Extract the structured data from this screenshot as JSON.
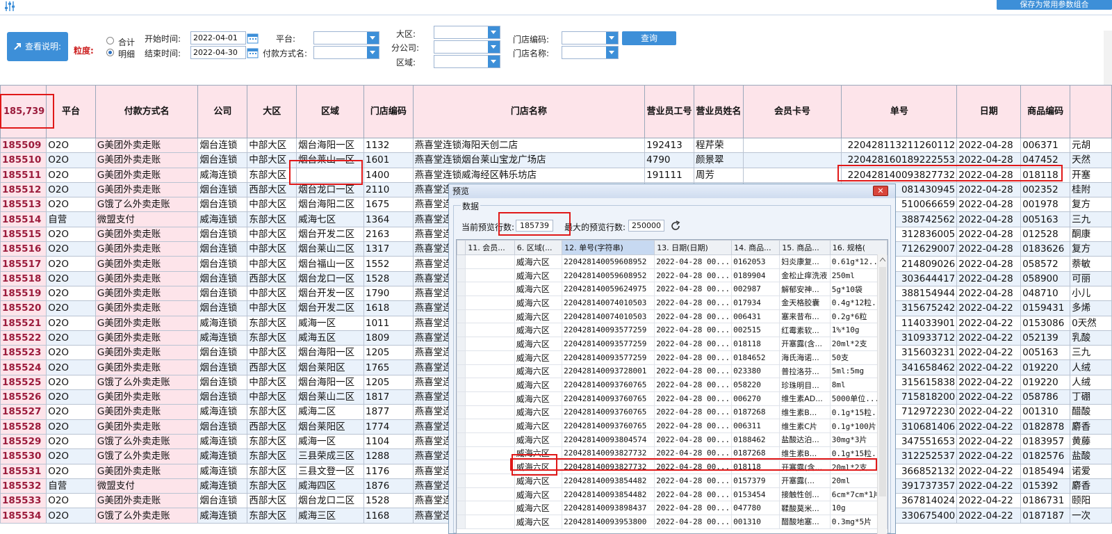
{
  "toolbar": {
    "save_combo_label": "保存为常用参数组合"
  },
  "filter": {
    "help_button": "查看说明:",
    "granularity_label": "粒度:",
    "radio_total": "合计",
    "radio_detail": "明细",
    "start_label": "开始时间:",
    "start_value": "2022-04-01",
    "end_label": "结束时间:",
    "end_value": "2022-04-30",
    "platform_label": "平台:",
    "payment_label": "付款方式名:",
    "region_label": "大区:",
    "branch_label": "分公司:",
    "area_label": "区域:",
    "store_code_label": "门店编码:",
    "store_name_label": "门店名称:",
    "query_button": "查询"
  },
  "main_table": {
    "total_count": "185,739",
    "headers": [
      "平台",
      "付款方式名",
      "公司",
      "大区",
      "区域",
      "门店编码",
      "门店名称",
      "营业员工号",
      "营业员姓名",
      "会员卡号",
      "单号",
      "日期",
      "商品编码"
    ],
    "rows": [
      [
        "185509",
        "O2O",
        "G美团外卖走账",
        "烟台连锁",
        "中部大区",
        "烟台海阳一区",
        "1132",
        "燕喜堂连锁海阳天创二店",
        "192413",
        "程芹荣",
        "",
        "220428113211260112",
        "2022-04-28",
        "006371",
        "元胡"
      ],
      [
        "185510",
        "O2O",
        "G美团外卖走账",
        "烟台连锁",
        "中部大区",
        "烟台莱山一区",
        "1601",
        "燕喜堂连锁烟台莱山宝龙广场店",
        "4790",
        "颜景翠",
        "",
        "220428160189222553",
        "2022-04-28",
        "047452",
        "天然"
      ],
      [
        "185511",
        "O2O",
        "G美团外卖走账",
        "威海连锁",
        "东部大区",
        "",
        "1400",
        "燕喜堂连锁威海经区韩乐坊店",
        "191111",
        "周芳",
        "",
        "220428140093827732",
        "2022-04-28",
        "018118",
        "开塞"
      ],
      [
        "185512",
        "O2O",
        "G美团外卖走账",
        "烟台连锁",
        "西部大区",
        "烟台龙口一区",
        "2110",
        "燕喜堂连",
        "",
        "",
        "",
        "081430945",
        "2022-04-28",
        "002352",
        "桂附"
      ],
      [
        "185513",
        "O2O",
        "G饿了么外卖走账",
        "烟台连锁",
        "中部大区",
        "烟台海阳二区",
        "1675",
        "燕喜堂连",
        "",
        "",
        "",
        "510066659",
        "2022-04-28",
        "001978",
        "复方"
      ],
      [
        "185514",
        "自营",
        "微盟支付",
        "威海连锁",
        "东部大区",
        "威海七区",
        "1364",
        "燕喜堂连",
        "",
        "",
        "",
        "388742562",
        "2022-04-28",
        "005163",
        "三九"
      ],
      [
        "185515",
        "O2O",
        "G美团外卖走账",
        "烟台连锁",
        "中部大区",
        "烟台开发二区",
        "2163",
        "燕喜堂连",
        "",
        "",
        "",
        "312836005",
        "2022-04-28",
        "012528",
        "酮康"
      ],
      [
        "185516",
        "O2O",
        "G美团外卖走账",
        "烟台连锁",
        "中部大区",
        "烟台莱山二区",
        "1317",
        "燕喜堂连",
        "",
        "",
        "",
        "712629007",
        "2022-04-28",
        "0183626",
        "复方"
      ],
      [
        "185517",
        "O2O",
        "G美团外卖走账",
        "烟台连锁",
        "中部大区",
        "烟台福山一区",
        "1552",
        "燕喜堂连",
        "",
        "",
        "",
        "214809026",
        "2022-04-28",
        "058572",
        "萘敏"
      ],
      [
        "185518",
        "O2O",
        "G美团外卖走账",
        "烟台连锁",
        "西部大区",
        "烟台龙口一区",
        "1528",
        "燕喜堂连",
        "",
        "",
        "",
        "303644417",
        "2022-04-28",
        "058900",
        "可丽"
      ],
      [
        "185519",
        "O2O",
        "G美团外卖走账",
        "烟台连锁",
        "中部大区",
        "烟台开发一区",
        "1790",
        "燕喜堂连",
        "",
        "",
        "",
        "388154944",
        "2022-04-28",
        "048710",
        "小儿"
      ],
      [
        "185520",
        "O2O",
        "G美团外卖走账",
        "烟台连锁",
        "中部大区",
        "烟台开发二区",
        "1618",
        "燕喜堂连",
        "",
        "",
        "",
        "315675242",
        "2022-04-22",
        "0159431",
        "多烯"
      ],
      [
        "185521",
        "O2O",
        "G美团外卖走账",
        "威海连锁",
        "东部大区",
        "威海一区",
        "1011",
        "燕喜堂连",
        "",
        "",
        "",
        "114033901",
        "2022-04-22",
        "0153086",
        "0天然"
      ],
      [
        "185522",
        "O2O",
        "G美团外卖走账",
        "威海连锁",
        "东部大区",
        "威海五区",
        "1809",
        "燕喜堂连",
        "",
        "",
        "",
        "310933712",
        "2022-04-22",
        "052139",
        "乳酸"
      ],
      [
        "185523",
        "O2O",
        "G美团外卖走账",
        "烟台连锁",
        "中部大区",
        "烟台海阳一区",
        "1205",
        "燕喜堂连",
        "",
        "",
        "",
        "315603231",
        "2022-04-22",
        "005163",
        "三九"
      ],
      [
        "185524",
        "O2O",
        "G美团外卖走账",
        "烟台连锁",
        "西部大区",
        "烟台莱阳区",
        "1765",
        "燕喜堂连",
        "",
        "",
        "",
        "341658462",
        "2022-04-22",
        "019220",
        "人绒"
      ],
      [
        "185525",
        "O2O",
        "G饿了么外卖走账",
        "烟台连锁",
        "中部大区",
        "烟台海阳一区",
        "1205",
        "燕喜堂连",
        "",
        "",
        "",
        "315615838",
        "2022-04-22",
        "019220",
        "人绒"
      ],
      [
        "185526",
        "O2O",
        "G美团外卖走账",
        "烟台连锁",
        "中部大区",
        "烟台莱山二区",
        "1817",
        "燕喜堂连",
        "",
        "",
        "",
        "715818200",
        "2022-04-22",
        "058786",
        "丁硼"
      ],
      [
        "185527",
        "O2O",
        "G美团外卖走账",
        "威海连锁",
        "东部大区",
        "威海二区",
        "1877",
        "燕喜堂连",
        "",
        "",
        "",
        "712972230",
        "2022-04-22",
        "001310",
        "醋酸"
      ],
      [
        "185528",
        "O2O",
        "G美团外卖走账",
        "烟台连锁",
        "西部大区",
        "烟台莱阳区",
        "1774",
        "燕喜堂连",
        "",
        "",
        "",
        "310681406",
        "2022-04-22",
        "0182878",
        "麝香"
      ],
      [
        "185529",
        "O2O",
        "G饿了么外卖走账",
        "威海连锁",
        "东部大区",
        "威海一区",
        "1104",
        "燕喜堂连",
        "",
        "",
        "",
        "347551653",
        "2022-04-22",
        "0183957",
        "黄藤"
      ],
      [
        "185530",
        "O2O",
        "G饿了么外卖走账",
        "威海连锁",
        "东部大区",
        "三县荣成三区",
        "1288",
        "燕喜堂连",
        "",
        "",
        "",
        "312252537",
        "2022-04-22",
        "0182576",
        "盐酸"
      ],
      [
        "185531",
        "O2O",
        "G美团外卖走账",
        "威海连锁",
        "东部大区",
        "三县文登一区",
        "1176",
        "燕喜堂连",
        "",
        "",
        "",
        "366852132",
        "2022-04-22",
        "0185494",
        "诺爱"
      ],
      [
        "185532",
        "自营",
        "微盟支付",
        "威海连锁",
        "东部大区",
        "威海四区",
        "1876",
        "燕喜堂连",
        "",
        "",
        "",
        "391737357",
        "2022-04-22",
        "015392",
        "麝香"
      ],
      [
        "185533",
        "O2O",
        "G美团外卖走账",
        "烟台连锁",
        "西部大区",
        "烟台龙口二区",
        "1528",
        "燕喜堂连",
        "",
        "",
        "",
        "367814024",
        "2022-04-22",
        "0186731",
        "颐阳"
      ],
      [
        "185534",
        "O2O",
        "G饿了么外卖走账",
        "威海连锁",
        "东部大区",
        "威海三区",
        "1168",
        "燕喜堂连",
        "",
        "",
        "",
        "330675400",
        "2022-04-22",
        "0187187",
        "一次"
      ]
    ]
  },
  "dialog": {
    "title": "预览",
    "close": "✕",
    "group_label": "数据",
    "current_rows_label": "当前预览行数:",
    "current_rows_value": "185739",
    "max_rows_label": "最大的预览行数:",
    "max_rows_value": "250000",
    "headers": [
      "11. 会员...",
      "6. 区域(...",
      "12. 单号(字符串)",
      "13. 日期(日期)",
      "14. 商品...",
      "15. 商品...",
      "16. 规格("
    ],
    "rows": [
      [
        "",
        "威海六区",
        "220428140059608952",
        "2022-04-28 00...",
        "0162053",
        "妇炎康复...",
        "0.61g*12..."
      ],
      [
        "",
        "威海六区",
        "220428140059608952",
        "2022-04-28 00...",
        "0189904",
        "金松止痒洗液",
        "250ml"
      ],
      [
        "",
        "威海六区",
        "220428140059624975",
        "2022-04-28 00...",
        "002987",
        "解郁安神...",
        "5g*10袋"
      ],
      [
        "",
        "威海六区",
        "220428140074010503",
        "2022-04-28 00...",
        "017934",
        "金天格胶囊",
        "0.4g*12粒..."
      ],
      [
        "",
        "威海六区",
        "220428140074010503",
        "2022-04-28 00...",
        "006431",
        "塞来昔布...",
        "0.2g*6粒"
      ],
      [
        "",
        "威海六区",
        "220428140093577259",
        "2022-04-28 00...",
        "002515",
        "红霉素软...",
        "1%*10g"
      ],
      [
        "",
        "威海六区",
        "220428140093577259",
        "2022-04-28 00...",
        "018118",
        "开塞露(含...",
        "20ml*2支"
      ],
      [
        "",
        "威海六区",
        "220428140093577259",
        "2022-04-28 00...",
        "0184652",
        "海氏海诺...",
        "50支"
      ],
      [
        "",
        "威海六区",
        "220428140093728001",
        "2022-04-28 00...",
        "023380",
        "普拉洛芬...",
        "5ml:5mg"
      ],
      [
        "",
        "威海六区",
        "220428140093760765",
        "2022-04-28 00...",
        "058220",
        "珍珠明目...",
        "8ml"
      ],
      [
        "",
        "威海六区",
        "220428140093760765",
        "2022-04-28 00...",
        "006270",
        "维生素AD...",
        "5000单位..."
      ],
      [
        "",
        "威海六区",
        "220428140093760765",
        "2022-04-28 00...",
        "0187268",
        "维生素B...",
        "0.1g*15粒..."
      ],
      [
        "",
        "威海六区",
        "220428140093760765",
        "2022-04-28 00...",
        "006311",
        "维生素C片",
        "0.1g*100片"
      ],
      [
        "",
        "威海六区",
        "220428140093804574",
        "2022-04-28 00...",
        "0188462",
        "盐酸达泊...",
        "30mg*3片"
      ],
      [
        "",
        "威海六区",
        "220428140093827732",
        "2022-04-28 00...",
        "0187268",
        "维生素B...",
        "0.1g*15粒..."
      ],
      [
        "",
        "威海六区",
        "220428140093827732",
        "2022-04-28 00...",
        "018118",
        "开塞露(含...",
        "20ml*2支"
      ],
      [
        "",
        "威海六区",
        "220428140093854482",
        "2022-04-28 00...",
        "0157379",
        "开塞露(...",
        "20ml"
      ],
      [
        "",
        "威海六区",
        "220428140093854482",
        "2022-04-28 00...",
        "0153454",
        "接触性创...",
        "6cm*7cm*1片"
      ],
      [
        "",
        "威海六区",
        "220428140093898437",
        "2022-04-28 00...",
        "047780",
        "鞣酸莫米...",
        "10g"
      ],
      [
        "",
        "威海六区",
        "220428140093953800",
        "2022-04-28 00...",
        "001310",
        "醋酸地塞...",
        "0.3mg*5片"
      ]
    ]
  }
}
